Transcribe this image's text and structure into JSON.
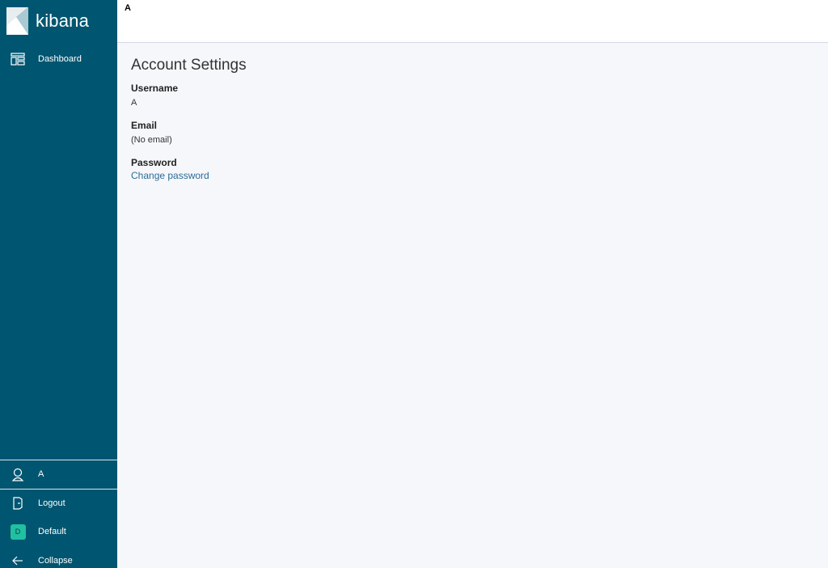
{
  "sidebar": {
    "brand": "kibana",
    "items": [
      {
        "label": "Dashboard",
        "icon": "dashboard-icon"
      }
    ],
    "footer": {
      "user_label": "A",
      "logout_label": "Logout",
      "space_initial": "D",
      "space_label": "Default",
      "collapse_label": "Collapse"
    }
  },
  "header": {
    "breadcrumb": "A"
  },
  "main": {
    "title": "Account Settings",
    "username_label": "Username",
    "username_value": "A",
    "email_label": "Email",
    "email_value": "(No email)",
    "password_label": "Password",
    "change_password_link": "Change password"
  },
  "colors": {
    "sidebar_bg": "#005571",
    "link": "#2b6c99",
    "space_avatar": "#20c0a0",
    "page_bg": "#f5f7fa"
  }
}
